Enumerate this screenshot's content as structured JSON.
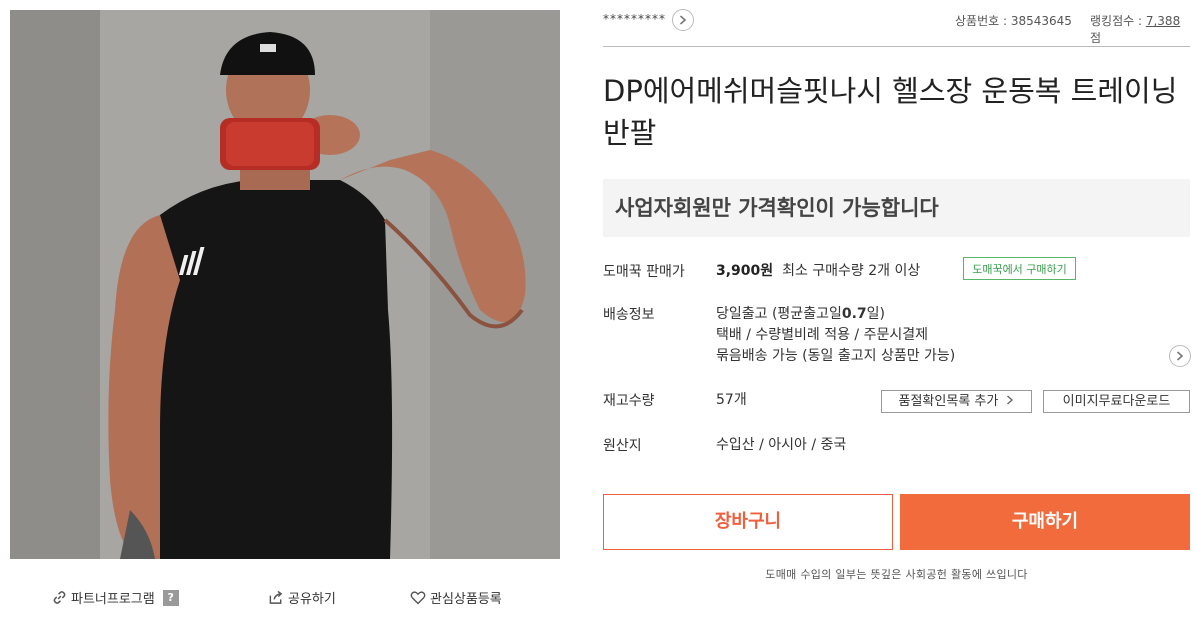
{
  "product_photo": {
    "alt": "DP에어메쉬머슬핏나시 헬스장 운동복 트레이닝 반팔"
  },
  "photo_actions": {
    "partner": "파트너프로그램",
    "partner_help": "?",
    "share": "공유하기",
    "favorite": "관심상품등록"
  },
  "header": {
    "seller": "*********",
    "product_number": "상품번호 : 38543645",
    "ranking_label": "랭킹점수 : ",
    "ranking_value": "7,388",
    "ranking_unit": "점"
  },
  "title": "DP에어메쉬머슬핏나시 헬스장 운동복 트레이닝 반팔",
  "notice": "사업자회원만 가격확인이 가능합니다",
  "price_row": {
    "label": "도매꾹 판매가",
    "price": "3,900원",
    "min_qty": "최소 구매수량 2개 이상",
    "wholesale_button": "도매꾹에서 구매하기"
  },
  "shipping": {
    "label": "배송정보",
    "line1_prefix": "당일출고 (평균출고일",
    "line1_bold": "0.7",
    "line1_suffix": "일)",
    "line2": "택배 / 수량별비례 적용 / 주문시결제",
    "line3": "묶음배송 가능 (동일 출고지 상품만 가능)"
  },
  "stock": {
    "label": "재고수량",
    "value": "57개",
    "soldout_button": "품절확인목록 추가",
    "image_button": "이미지무료다운로드"
  },
  "origin": {
    "label": "원산지",
    "value": "수입산 / 아시아 / 중국"
  },
  "actions": {
    "cart": "장바구니",
    "buy": "구매하기"
  },
  "footnote": "도매매 수입의 일부는 뜻깊은 사회공헌 활동에 쓰입니다",
  "colors": {
    "accent": "#f26b3d",
    "green": "#3a9c4d"
  }
}
